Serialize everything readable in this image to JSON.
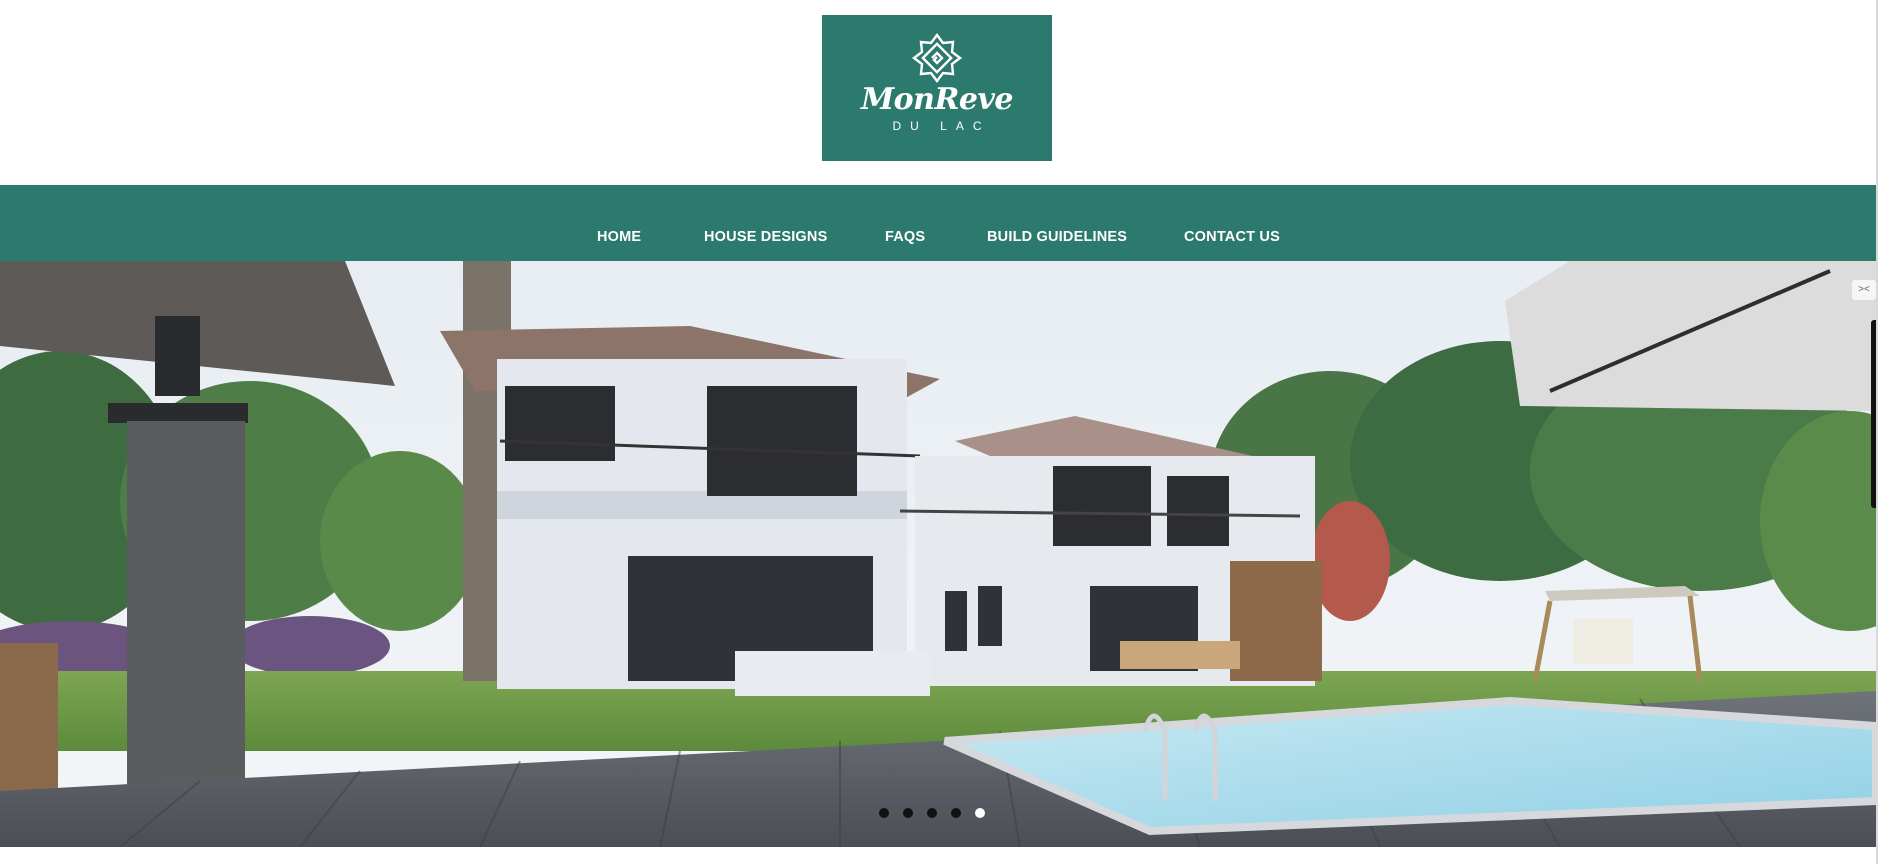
{
  "brand": {
    "name": "MonReve",
    "subtitle": "DU LAC",
    "color": "#2c7a6e"
  },
  "nav": {
    "items": [
      {
        "label": "HOME"
      },
      {
        "label": "HOUSE DESIGNS"
      },
      {
        "label": "FAQS"
      },
      {
        "label": "BUILD GUIDELINES"
      },
      {
        "label": "CONTACT US"
      }
    ]
  },
  "hero": {
    "slide_count": 5,
    "active_slide": 5,
    "expand_glyph": "><"
  },
  "icons": [
    "logo-emblem-icon",
    "expand-icon"
  ]
}
